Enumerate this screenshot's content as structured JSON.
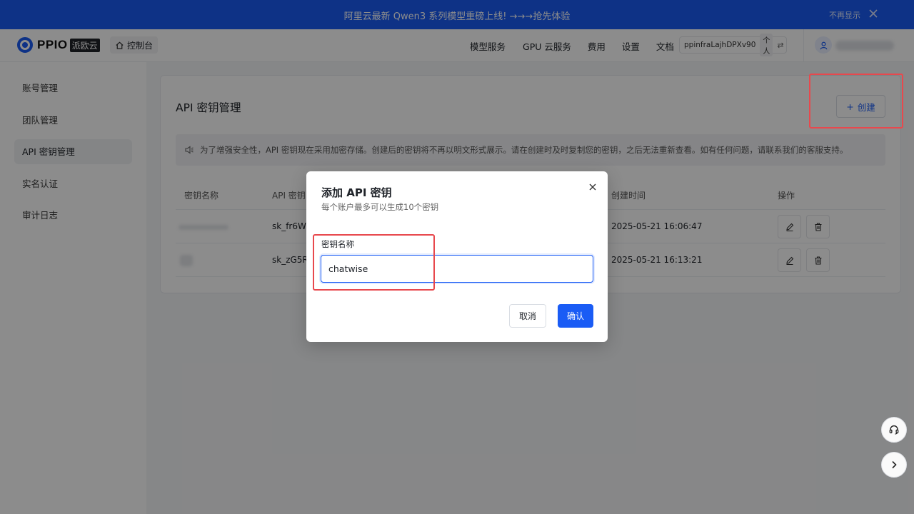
{
  "announcement": {
    "text": "阿里云最新 Qwen3 系列模型重磅上线! →→→抢先体验",
    "dismiss_label": "不再显示",
    "close_icon": "close-icon"
  },
  "header": {
    "logo_text": "PPIO",
    "logo_badge": "派欧云",
    "console_label": "控制台",
    "nav": [
      "模型服务",
      "GPU 云服务",
      "费用",
      "设置",
      "文档"
    ],
    "account_id": "ppinfraLajhDPXv90",
    "account_type": "个人",
    "switch_glyph": "⇄"
  },
  "sidebar": {
    "items": [
      {
        "label": "账号管理"
      },
      {
        "label": "团队管理"
      },
      {
        "label": "API 密钥管理"
      },
      {
        "label": "实名认证"
      },
      {
        "label": "审计日志"
      }
    ],
    "active_index": 2
  },
  "page": {
    "title": "API 密钥管理",
    "create_label": "创建",
    "create_glyph": "+",
    "notice": "为了增强安全性，API 密钥现在采用加密存储。创建后的密钥将不再以明文形式展示。请在创建时及时复制您的密钥，之后无法重新查看。如有任何问题，请联系我们的客服支持。"
  },
  "table": {
    "columns": {
      "name": "密钥名称",
      "key": "API 密钥",
      "created": "创建时间",
      "actions": "操作"
    },
    "rows": [
      {
        "key": "sk_fr6W*",
        "created": "2025-05-21 16:06:47"
      },
      {
        "key": "sk_zG5R*",
        "created": "2025-05-21 16:13:21"
      }
    ]
  },
  "modal": {
    "title": "添加 API 密钥",
    "subtitle": "每个账户最多可以生成10个密钥",
    "field_label": "密钥名称",
    "field_value": "chatwise",
    "cancel_label": "取消",
    "confirm_label": "确认"
  },
  "colors": {
    "accent": "#1a5cf5",
    "highlight": "#e8484d"
  }
}
